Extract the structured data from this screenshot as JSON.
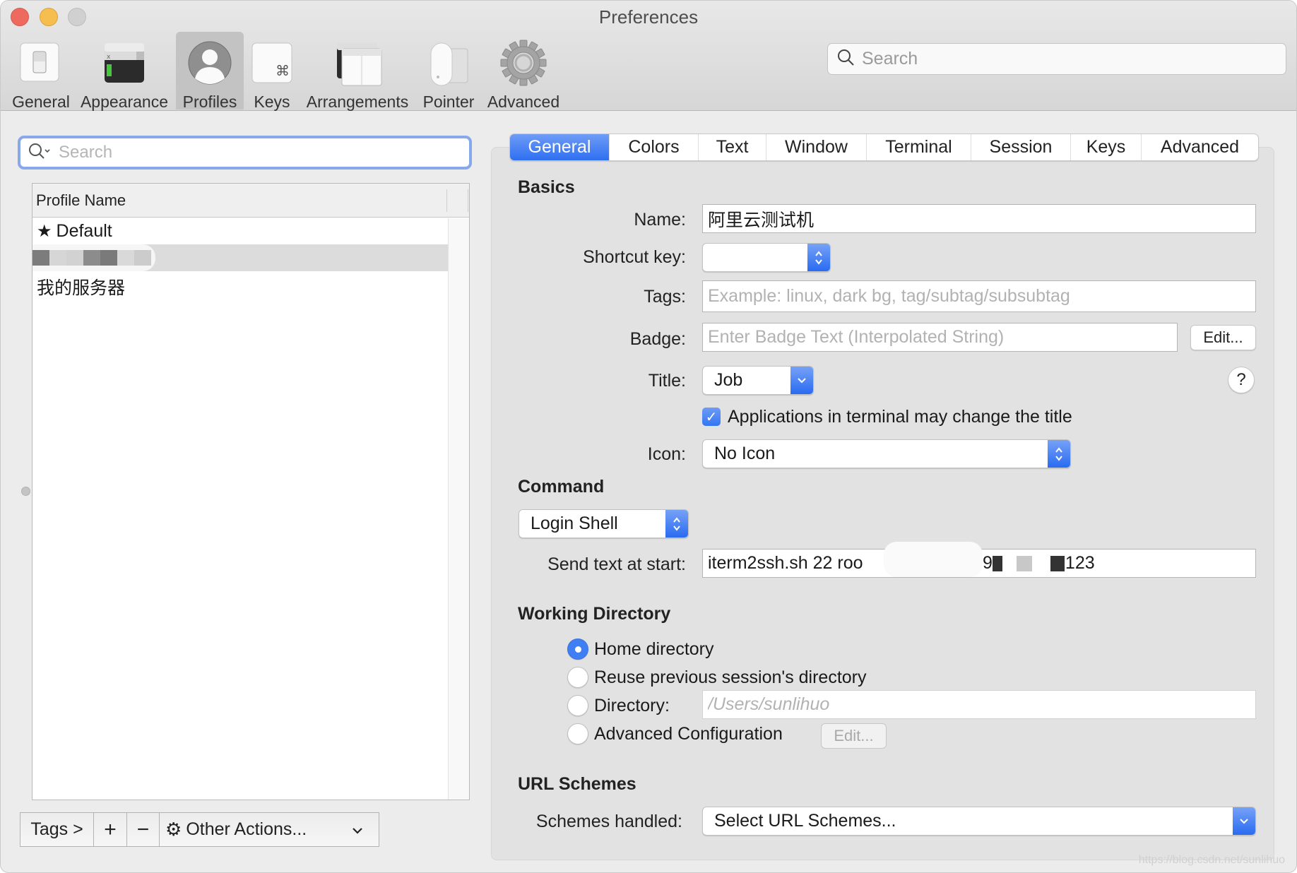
{
  "window": {
    "title": "Preferences",
    "traffic_lights": [
      "close",
      "minimize",
      "zoom"
    ]
  },
  "toolbar": {
    "items": [
      {
        "label": "General",
        "icon": "switch-icon",
        "selected": false
      },
      {
        "label": "Appearance",
        "icon": "terminal-window-icon",
        "selected": false
      },
      {
        "label": "Profiles",
        "icon": "user-silhouette-icon",
        "selected": true
      },
      {
        "label": "Keys",
        "icon": "command-key-icon",
        "selected": false
      },
      {
        "label": "Arrangements",
        "icon": "windows-icon",
        "selected": false
      },
      {
        "label": "Pointer",
        "icon": "mouse-icon",
        "selected": false
      },
      {
        "label": "Advanced",
        "icon": "gear-icon",
        "selected": false
      }
    ],
    "search_placeholder": "Search"
  },
  "profiles": {
    "search_placeholder": "Search",
    "column_header": "Profile Name",
    "rows": [
      {
        "label": "Default",
        "starred": true,
        "selected": false
      },
      {
        "label": "",
        "redacted": true,
        "selected": true
      },
      {
        "label": "我的服务器",
        "starred": false,
        "selected": false
      }
    ],
    "bottom_bar": {
      "tags_label": "Tags >",
      "add_label": "+",
      "remove_label": "−",
      "other_actions_label": "Other Actions..."
    }
  },
  "tabs": [
    {
      "label": "General",
      "active": true
    },
    {
      "label": "Colors",
      "active": false
    },
    {
      "label": "Text",
      "active": false
    },
    {
      "label": "Window",
      "active": false
    },
    {
      "label": "Terminal",
      "active": false
    },
    {
      "label": "Session",
      "active": false
    },
    {
      "label": "Keys",
      "active": false
    },
    {
      "label": "Advanced",
      "active": false
    }
  ],
  "general": {
    "basics_title": "Basics",
    "name_label": "Name:",
    "name_value": "阿里云测试机",
    "shortcut_label": "Shortcut key:",
    "shortcut_value": "",
    "tags_label": "Tags:",
    "tags_placeholder": "Example: linux, dark bg, tag/subtag/subsubtag",
    "badge_label": "Badge:",
    "badge_placeholder": "Enter Badge Text (Interpolated String)",
    "badge_edit_label": "Edit...",
    "title_label": "Title:",
    "title_value": "Job",
    "help_label": "?",
    "apps_change_title_label": "Applications in terminal may change the title",
    "apps_change_title_checked": true,
    "icon_label": "Icon:",
    "icon_value": "No Icon",
    "command_title": "Command",
    "command_value": "Login Shell",
    "send_text_label": "Send text at start:",
    "send_text_value_visible_parts": [
      "iterm2ssh.sh 22 roo",
      "l99",
      "123"
    ],
    "working_dir_title": "Working Directory",
    "working_dir_options": [
      {
        "label": "Home directory",
        "selected": true
      },
      {
        "label": "Reuse previous session's directory",
        "selected": false
      },
      {
        "label": "Directory:",
        "selected": false
      },
      {
        "label": "Advanced Configuration",
        "selected": false
      }
    ],
    "directory_placeholder": "/Users/sunlihuo",
    "advanced_config_edit_label": "Edit...",
    "url_schemes_title": "URL Schemes",
    "schemes_handled_label": "Schemes handled:",
    "schemes_handled_value": "Select URL Schemes..."
  },
  "watermark": "https://blog.csdn.net/sunlihuo"
}
